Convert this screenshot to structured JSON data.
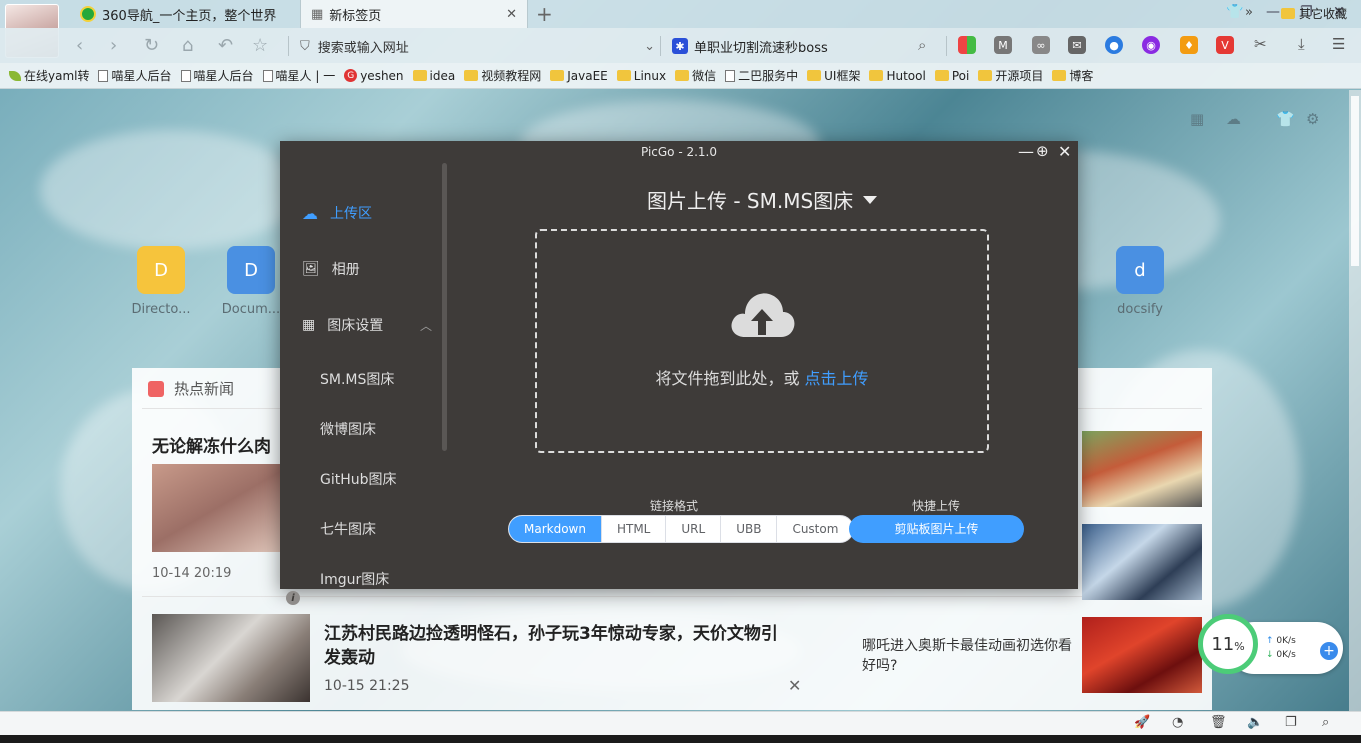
{
  "tabs": [
    {
      "title": "360导航_一个主页，整个世界"
    },
    {
      "title": "新标签页"
    }
  ],
  "address_bar": {
    "placeholder": "搜索或输入网址"
  },
  "search_box": {
    "text": "单职业切割流速秒boss"
  },
  "bookmarks": [
    {
      "label": "在线yaml转",
      "icon": "leaf-icon"
    },
    {
      "label": "喵星人后台",
      "icon": "page-icon"
    },
    {
      "label": "喵星人后台",
      "icon": "page-icon"
    },
    {
      "label": "喵星人 | 一",
      "icon": "page-icon"
    },
    {
      "label": "yeshen",
      "icon": "g-icon"
    },
    {
      "label": "idea",
      "icon": "folder-icon"
    },
    {
      "label": "视频教程网",
      "icon": "folder-icon"
    },
    {
      "label": "JavaEE",
      "icon": "folder-icon"
    },
    {
      "label": "Linux",
      "icon": "folder-icon"
    },
    {
      "label": "微信",
      "icon": "folder-icon"
    },
    {
      "label": "二巴服务中",
      "icon": "page-icon"
    },
    {
      "label": "UI框架",
      "icon": "folder-icon"
    },
    {
      "label": "Hutool",
      "icon": "folder-icon"
    },
    {
      "label": "Poi",
      "icon": "folder-icon"
    },
    {
      "label": "开源项目",
      "icon": "folder-icon"
    },
    {
      "label": "博客",
      "icon": "folder-icon"
    }
  ],
  "bookmarks_more": "»",
  "bookmarks_other": "其它收藏",
  "shortcuts": [
    {
      "letter": "D",
      "label": "Directo...",
      "color": "#f6c43c"
    },
    {
      "letter": "D",
      "label": "Docum...",
      "color": "#4a90e2"
    },
    {
      "letter": "d",
      "label": "docsify",
      "color": "#4a90e2"
    }
  ],
  "news": {
    "header": "热点新闻",
    "item1": {
      "title": "无论解冻什么肉",
      "time": "10-14 20:19"
    },
    "item2": {
      "title": "江苏村民路边捡透明怪石，孙子玩3年惊动专家，天价文物引发轰动",
      "time": "10-15 21:25"
    },
    "side_text": "哪吒进入奥斯卡最佳动画初选你看好吗?"
  },
  "speed_widget": {
    "percent": "11",
    "percent_sign": "%",
    "up": "0K/s",
    "down": "0K/s"
  },
  "picgo": {
    "window_title": "PicGo - 2.1.0",
    "menu": [
      {
        "label": "上传区",
        "icon": "cloud-upload-icon",
        "active": true
      },
      {
        "label": "相册",
        "icon": "picture-icon",
        "active": false
      },
      {
        "label": "图床设置",
        "icon": "grid-icon",
        "active": false
      }
    ],
    "submenu": [
      "SM.MS图床",
      "微博图床",
      "GitHub图床",
      "七牛图床",
      "Imgur图床"
    ],
    "heading": "图片上传 - SM.MS图床",
    "drop_text": "将文件拖到此处，或",
    "drop_link": "点击上传",
    "link_format_label": "链接格式",
    "formats": [
      "Markdown",
      "HTML",
      "URL",
      "UBB",
      "Custom"
    ],
    "selected_format": "Markdown",
    "quick_upload_label": "快捷上传",
    "clipboard_button": "剪贴板图片上传"
  },
  "colors": {
    "accent": "#409eff",
    "picgo_bg": "#3e3b39"
  }
}
